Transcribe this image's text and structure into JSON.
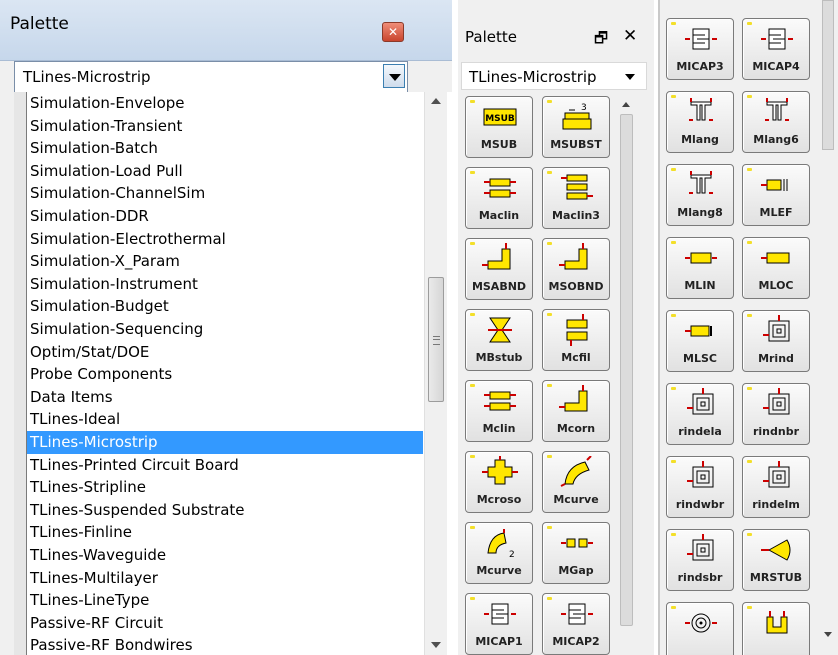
{
  "palette_dropdown": {
    "title": "Palette",
    "selected": "TLines-Microstrip",
    "items": [
      "Simulation-Envelope",
      "Simulation-Transient",
      "Simulation-Batch",
      "Simulation-Load Pull",
      "Simulation-ChannelSim",
      "Simulation-DDR",
      "Simulation-Electrothermal",
      "Simulation-X_Param",
      "Simulation-Instrument",
      "Simulation-Budget",
      "Simulation-Sequencing",
      "Optim/Stat/DOE",
      "Probe Components",
      "Data Items",
      "TLines-Ideal",
      "TLines-Microstrip",
      "TLines-Printed Circuit Board",
      "TLines-Stripline",
      "TLines-Suspended Substrate",
      "TLines-Finline",
      "TLines-Waveguide",
      "TLines-Multilayer",
      "TLines-LineType",
      "Passive-RF Circuit",
      "Passive-RF Bondwires"
    ],
    "selected_index": 15
  },
  "palette_docked": {
    "title": "Palette",
    "pin_glyph": "🗗",
    "close_glyph": "✕",
    "selected": "TLines-Microstrip",
    "components": [
      {
        "label": "MSUB",
        "icon": "msub-icon"
      },
      {
        "label": "MSUBST",
        "icon": "msubst-icon"
      },
      {
        "label": "Maclin",
        "icon": "coupled-lines-icon"
      },
      {
        "label": "Maclin3",
        "icon": "coupled-lines-3-icon"
      },
      {
        "label": "MSABND",
        "icon": "bend-icon"
      },
      {
        "label": "MSOBND",
        "icon": "bend-icon"
      },
      {
        "label": "MBstub",
        "icon": "butterfly-stub-icon"
      },
      {
        "label": "Mcfil",
        "icon": "coupled-filter-icon"
      },
      {
        "label": "Mclin",
        "icon": "coupled-lines-icon"
      },
      {
        "label": "Mcorn",
        "icon": "corner-icon"
      },
      {
        "label": "Mcroso",
        "icon": "cross-icon"
      },
      {
        "label": "Mcurve",
        "icon": "curve-icon"
      },
      {
        "label": "Mcurve",
        "icon": "curve2-icon"
      },
      {
        "label": "MGap",
        "icon": "gap-icon"
      },
      {
        "label": "MICAP1",
        "icon": "interdigital-cap-icon"
      },
      {
        "label": "MICAP2",
        "icon": "interdigital-cap-icon"
      }
    ]
  },
  "palette_extra": {
    "components": [
      {
        "label": "MICAP3",
        "icon": "interdigital-cap-icon"
      },
      {
        "label": "MICAP4",
        "icon": "interdigital-cap-icon"
      },
      {
        "label": "Mlang",
        "icon": "lange-coupler-icon"
      },
      {
        "label": "Mlang6",
        "icon": "lange-coupler-icon"
      },
      {
        "label": "Mlang8",
        "icon": "lange-coupler-icon"
      },
      {
        "label": "MLEF",
        "icon": "open-end-effect-icon"
      },
      {
        "label": "MLIN",
        "icon": "line-icon"
      },
      {
        "label": "MLOC",
        "icon": "open-stub-icon"
      },
      {
        "label": "MLSC",
        "icon": "short-stub-icon"
      },
      {
        "label": "Mrind",
        "icon": "spiral-inductor-icon"
      },
      {
        "label": "rindela",
        "icon": "spiral-inductor-icon"
      },
      {
        "label": "rindnbr",
        "icon": "spiral-inductor-icon"
      },
      {
        "label": "rindwbr",
        "icon": "spiral-inductor-icon"
      },
      {
        "label": "rindelm",
        "icon": "spiral-inductor-icon"
      },
      {
        "label": "rindsbr",
        "icon": "spiral-inductor-icon"
      },
      {
        "label": "MRSTUB",
        "icon": "radial-stub-icon"
      },
      {
        "label": "",
        "icon": "round-spiral-icon"
      },
      {
        "label": "",
        "icon": "u-bend-icon"
      }
    ]
  },
  "colors": {
    "selection": "#3399ff",
    "pin_red": "#cc0000",
    "component_fill": "#ffe600",
    "tile_dot": "#f3df2a"
  }
}
